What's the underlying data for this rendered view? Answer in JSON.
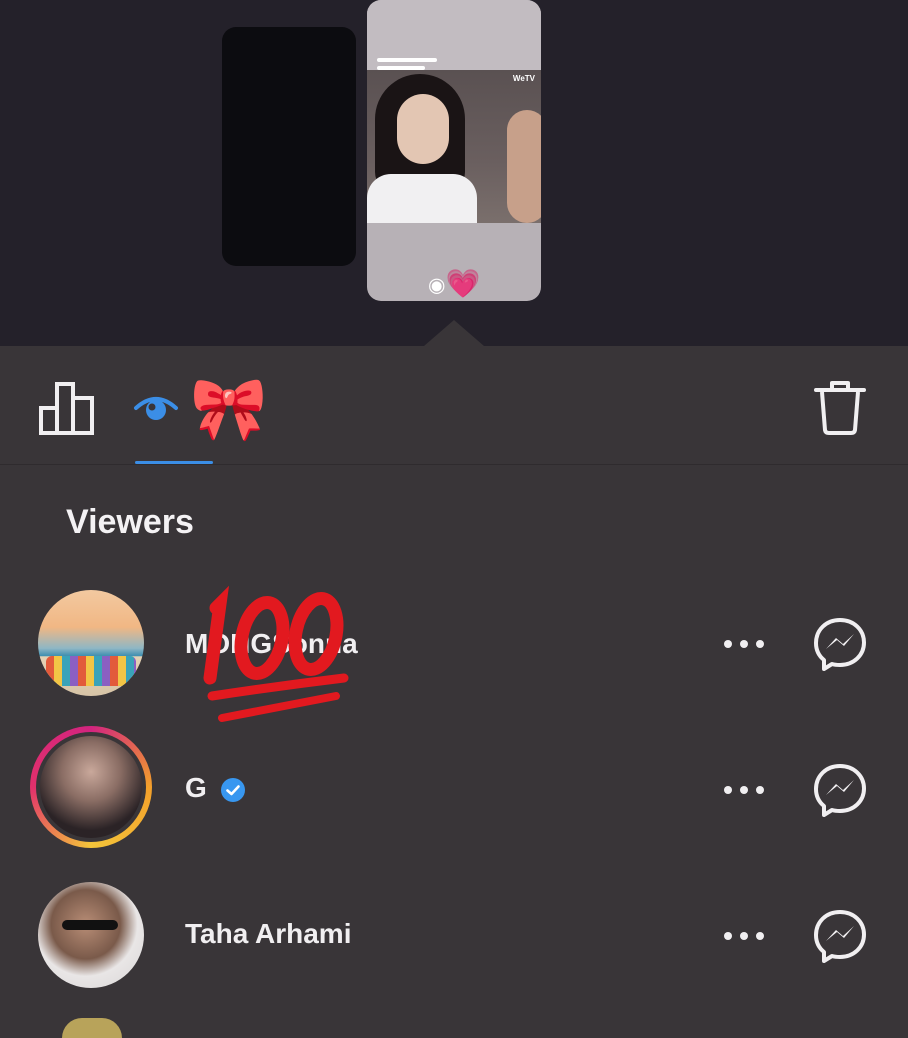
{
  "stories": {
    "left_emoji": "👏",
    "right_overlay": {
      "eye_symbol": "◉",
      "heart": "💗"
    },
    "right_watermark": "WeTV"
  },
  "tabs": {
    "insights_icon": "bar-chart-icon",
    "viewers_icon": "eye-icon",
    "sticker": "🎀",
    "delete_icon": "trash-icon",
    "active_color": "#3b8ee6"
  },
  "viewers": {
    "title": "Viewers",
    "items": [
      {
        "name": "MOHGSonna",
        "verified": false,
        "avatar": "beach-avatar"
      },
      {
        "name": "G",
        "verified": true,
        "avatar": "portrait-avatar"
      },
      {
        "name": "Taha Arhami",
        "verified": false,
        "avatar": "sunglasses-avatar"
      }
    ],
    "overlay_sticker": "100-emoji"
  },
  "colors": {
    "background": "#393538",
    "top_background": "#24212a",
    "verified_blue": "#3897f0",
    "hundred_red": "#e2191f"
  }
}
